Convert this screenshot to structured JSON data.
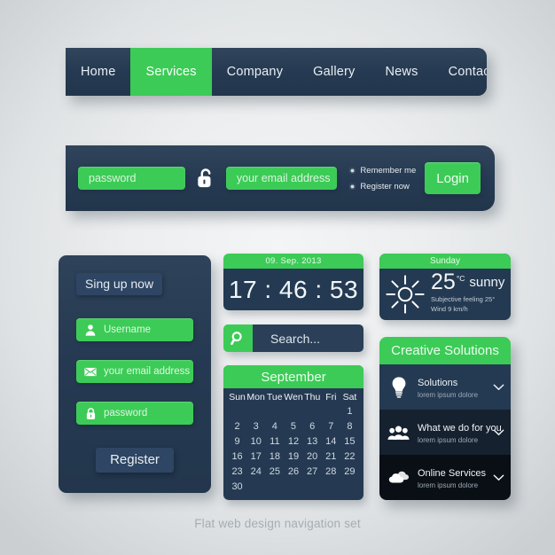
{
  "topnav": {
    "items": [
      {
        "label": "Home",
        "active": false
      },
      {
        "label": "Services",
        "active": true
      },
      {
        "label": "Company",
        "active": false
      },
      {
        "label": "Gallery",
        "active": false
      },
      {
        "label": "News",
        "active": false
      },
      {
        "label": "Contact us",
        "active": false
      }
    ]
  },
  "loginbar": {
    "password_value": "password",
    "email_value": "your email address",
    "lock_icon": "lock-open-icon",
    "remember_label": "Remember me",
    "register_label": "Register now",
    "login_label": "Login"
  },
  "signup": {
    "title": "Sing up now",
    "fields": [
      {
        "icon": "user-icon",
        "value": "Username"
      },
      {
        "icon": "envelope-icon",
        "value": "your email address"
      },
      {
        "icon": "lock-icon",
        "value": "password"
      }
    ],
    "register_label": "Register"
  },
  "clock": {
    "date": "09. Sep. 2013",
    "time": "17 : 46 : 53"
  },
  "search": {
    "icon": "magnifier-icon",
    "value": "Search..."
  },
  "calendar": {
    "month": "September",
    "weekdays": [
      "Sun",
      "Mon",
      "Tue",
      "Wen",
      "Thu",
      "Fri",
      "Sat"
    ],
    "leading_blanks": 6,
    "days": [
      1,
      2,
      3,
      4,
      5,
      6,
      7,
      8,
      9,
      10,
      11,
      12,
      13,
      14,
      15,
      16,
      17,
      18,
      19,
      20,
      21,
      22,
      23,
      24,
      25,
      26,
      27,
      28,
      29,
      30
    ]
  },
  "weather": {
    "day": "Sunday",
    "icon": "sun-icon",
    "temperature": "25",
    "unit": "°C",
    "condition": "sunny",
    "subjective": "Subjective feeling  25°",
    "wind": "Wind 9 km/h"
  },
  "accordion": {
    "title": "Creative Solutions",
    "items": [
      {
        "icon": "lightbulb-icon",
        "heading": "Solutions",
        "sub": "lorem ipsum dolore",
        "chevron": "chevron-down-icon"
      },
      {
        "icon": "people-icon",
        "heading": "What we do for you",
        "sub": "lorem ipsum dolore",
        "chevron": "chevron-down-icon"
      },
      {
        "icon": "cloud-icon",
        "heading": "Online Services",
        "sub": "lorem ipsum dolore",
        "chevron": "chevron-down-icon"
      }
    ]
  },
  "caption": "Flat web design navigation set",
  "colors": {
    "green": "#3ccb56",
    "navy": "#253a52",
    "navy_dark": "#16212f",
    "navy_darkest": "#0a0f16",
    "text_light": "#eef3f7"
  }
}
